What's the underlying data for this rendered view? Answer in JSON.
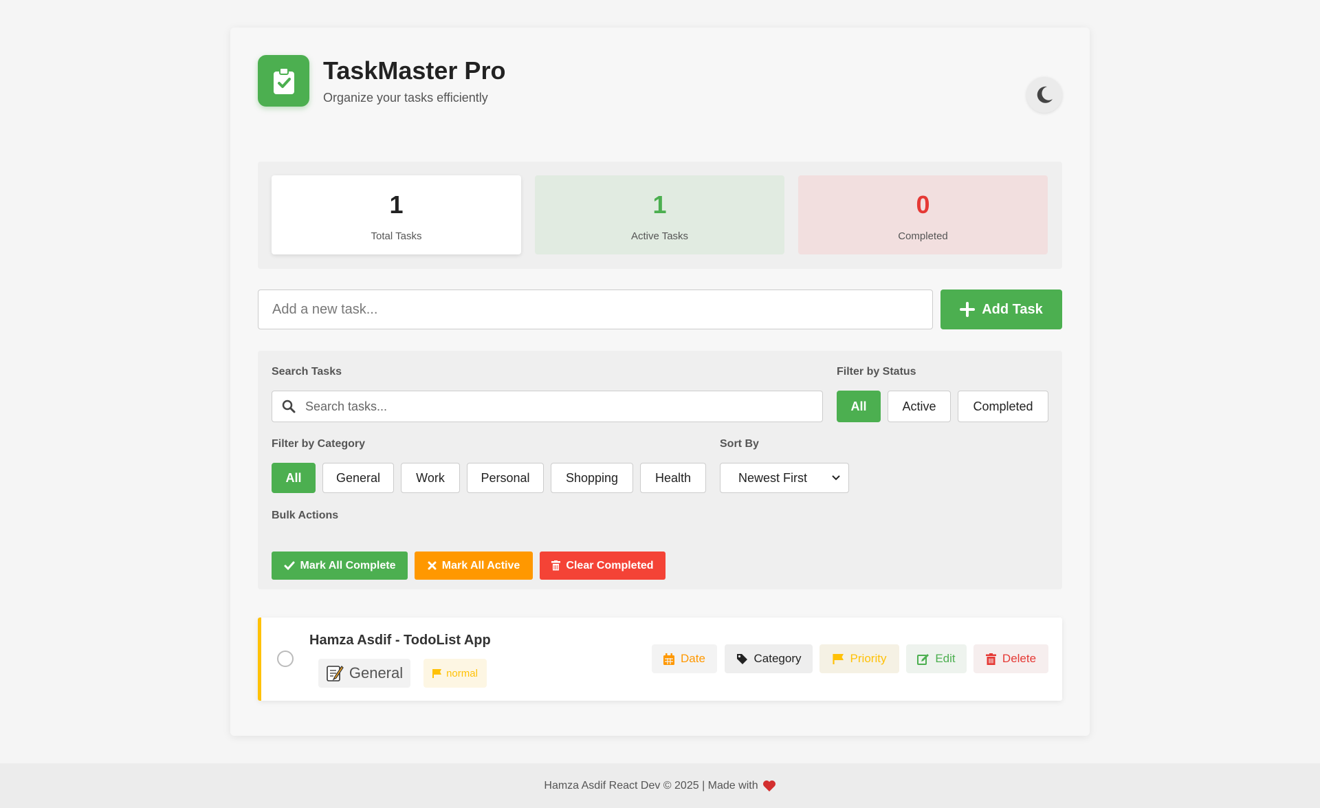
{
  "header": {
    "title": "TaskMaster Pro",
    "subtitle": "Organize your tasks efficiently",
    "logo_icon": "clipboard-check-icon",
    "theme_icon": "moon-icon"
  },
  "stats": [
    {
      "value": "1",
      "label": "Total Tasks"
    },
    {
      "value": "1",
      "label": "Active Tasks"
    },
    {
      "value": "0",
      "label": "Completed"
    }
  ],
  "add": {
    "placeholder": "Add a new task...",
    "button_label": "Add Task"
  },
  "filters": {
    "search_label": "Search Tasks",
    "search_placeholder": "Search tasks...",
    "status_label": "Filter by Status",
    "status_options": [
      "All",
      "Active",
      "Completed"
    ],
    "status_selected": "All",
    "category_label": "Filter by Category",
    "category_options": [
      "All",
      "General",
      "Work",
      "Personal",
      "Shopping",
      "Health"
    ],
    "category_selected": "All",
    "sort_label": "Sort By",
    "sort_value": "Newest First",
    "bulk_label": "Bulk Actions",
    "bulk": {
      "complete": "Mark All Complete",
      "active": "Mark All Active",
      "clear": "Clear Completed"
    }
  },
  "tasks": [
    {
      "title": "Hamza Asdif - TodoList App",
      "category": "General",
      "category_icon": "memo-icon",
      "priority": "normal",
      "completed": false,
      "actions": {
        "date": "Date",
        "category": "Category",
        "priority": "Priority",
        "edit": "Edit",
        "delete": "Delete"
      }
    }
  ],
  "footer": {
    "text": "Hamza Asdif React Dev © 2025 | Made with"
  },
  "colors": {
    "accent": "#4caf50",
    "warning": "#ff9800",
    "danger": "#f44336",
    "priority": "#ffc107"
  }
}
